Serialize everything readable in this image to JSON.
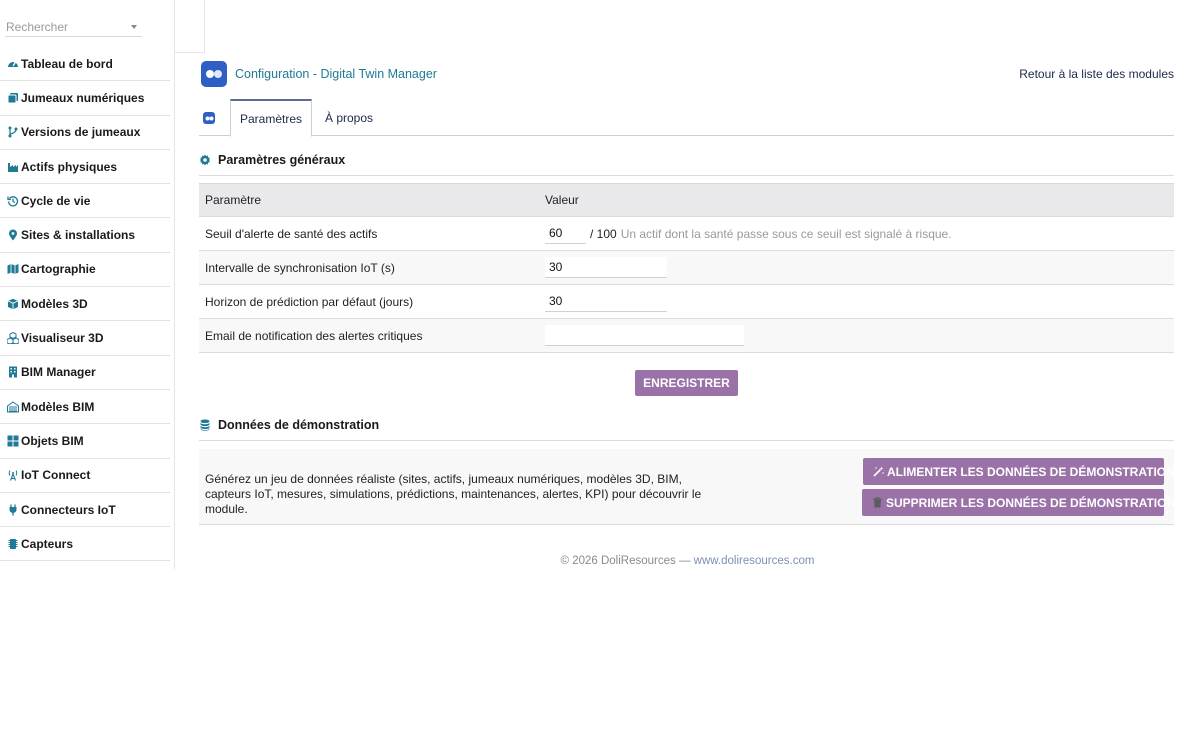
{
  "sidebar": {
    "search_placeholder": "Rechercher",
    "items": [
      {
        "label": "Tableau de bord",
        "icon": "dashboard-icon"
      },
      {
        "label": "Jumeaux numériques",
        "icon": "copy-icon"
      },
      {
        "label": "Versions de jumeaux",
        "icon": "branch-icon"
      },
      {
        "label": "Actifs physiques",
        "icon": "factory-icon"
      },
      {
        "label": "Cycle de vie",
        "icon": "history-icon"
      },
      {
        "label": "Sites & installations",
        "icon": "map-pin-icon"
      },
      {
        "label": "Cartographie",
        "icon": "map-icon"
      },
      {
        "label": "Modèles 3D",
        "icon": "cube-icon"
      },
      {
        "label": "Visualiseur 3D",
        "icon": "cubes-icon"
      },
      {
        "label": "BIM Manager",
        "icon": "building-icon"
      },
      {
        "label": "Modèles BIM",
        "icon": "city-icon"
      },
      {
        "label": "Objets BIM",
        "icon": "grid-icon"
      },
      {
        "label": "IoT Connect",
        "icon": "broadcast-icon"
      },
      {
        "label": "Connecteurs IoT",
        "icon": "plug-icon"
      },
      {
        "label": "Capteurs",
        "icon": "microchip-icon"
      }
    ]
  },
  "header": {
    "title": "Configuration - Digital Twin Manager",
    "back_link": "Retour à la liste des modules"
  },
  "tabs": [
    {
      "label": "Paramètres",
      "active": true
    },
    {
      "label": "À propos",
      "active": false
    }
  ],
  "general": {
    "title": "Paramètres généraux",
    "col_param": "Paramètre",
    "col_value": "Valeur",
    "rows": [
      {
        "label": "Seuil d'alerte de santé des actifs",
        "value": "60",
        "unit": "/ 100",
        "hint": "Un actif dont la santé passe sous ce seuil est signalé à risque."
      },
      {
        "label": "Intervalle de synchronisation IoT (s)",
        "value": "30"
      },
      {
        "label": "Horizon de prédiction par défaut (jours)",
        "value": "30"
      },
      {
        "label": "Email de notification des alertes critiques",
        "value": ""
      }
    ],
    "save_label": "ENREGISTRER"
  },
  "demo": {
    "title": "Données de démonstration",
    "description": "Générez un jeu de données réaliste (sites, actifs, jumeaux numériques, modèles 3D, BIM, capteurs IoT, mesures, simulations, prédictions, maintenances, alertes, KPI) pour découvrir le module.",
    "feed_label": "ALIMENTER LES DONNÉES DE DÉMONSTRATION",
    "delete_label": "SUPPRIMER LES DONNÉES DE DÉMONSTRATION"
  },
  "footer": {
    "copyright": "© 2026 DoliResources —",
    "site": "www.doliresources.com"
  },
  "colors": {
    "accent": "#1f7a95",
    "button": "#9a72a8",
    "logo": "#2d5fc4"
  }
}
